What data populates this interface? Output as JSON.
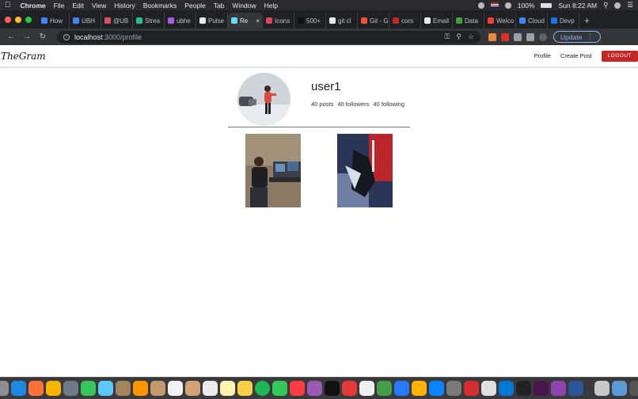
{
  "menubar": {
    "apple_icon": "apple-icon",
    "items": [
      "Chrome",
      "File",
      "Edit",
      "View",
      "History",
      "Bookmarks",
      "People",
      "Tab",
      "Window",
      "Help"
    ],
    "battery": "100%",
    "clock": "Sun 8:22 AM"
  },
  "tabs": [
    {
      "label": "How",
      "color": "#4285f4"
    },
    {
      "label": "UBH",
      "color": "#4285f4"
    },
    {
      "label": "@UB",
      "color": "#e04f5f"
    },
    {
      "label": "Strea",
      "color": "#2bbd8c"
    },
    {
      "label": "ubhe",
      "color": "#a45ee5"
    },
    {
      "label": "Pulse",
      "color": "#e8eaed"
    },
    {
      "label": "Re",
      "color": "#61dafb",
      "active": true
    },
    {
      "label": "Icons",
      "color": "#e0445a"
    },
    {
      "label": "500+",
      "color": "#111111"
    },
    {
      "label": "git cl",
      "color": "#e8eaed"
    },
    {
      "label": "Git - G",
      "color": "#f05133"
    },
    {
      "label": "cors",
      "color": "#c62828"
    },
    {
      "label": "Email",
      "color": "#e8eaed"
    },
    {
      "label": "Data",
      "color": "#3fa037"
    },
    {
      "label": "Welco",
      "color": "#ea4335"
    },
    {
      "label": "Cloud",
      "color": "#4285f4"
    },
    {
      "label": "Devp",
      "color": "#1a73e8"
    }
  ],
  "toolbar": {
    "url_host": "localhost",
    "url_path": ":3000/profile",
    "update_label": "Update"
  },
  "app": {
    "brand": "TheGram",
    "nav": {
      "profile": "Profile",
      "create_post": "Create Post",
      "logout": "LOGOUT"
    }
  },
  "profile": {
    "username": "user1",
    "posts": "40 posts",
    "followers": "40 followers",
    "following": "40 following"
  },
  "colors": {
    "logout_bg": "#c62828",
    "chrome_dark": "#202124",
    "chrome_toolbar": "#35363a"
  }
}
